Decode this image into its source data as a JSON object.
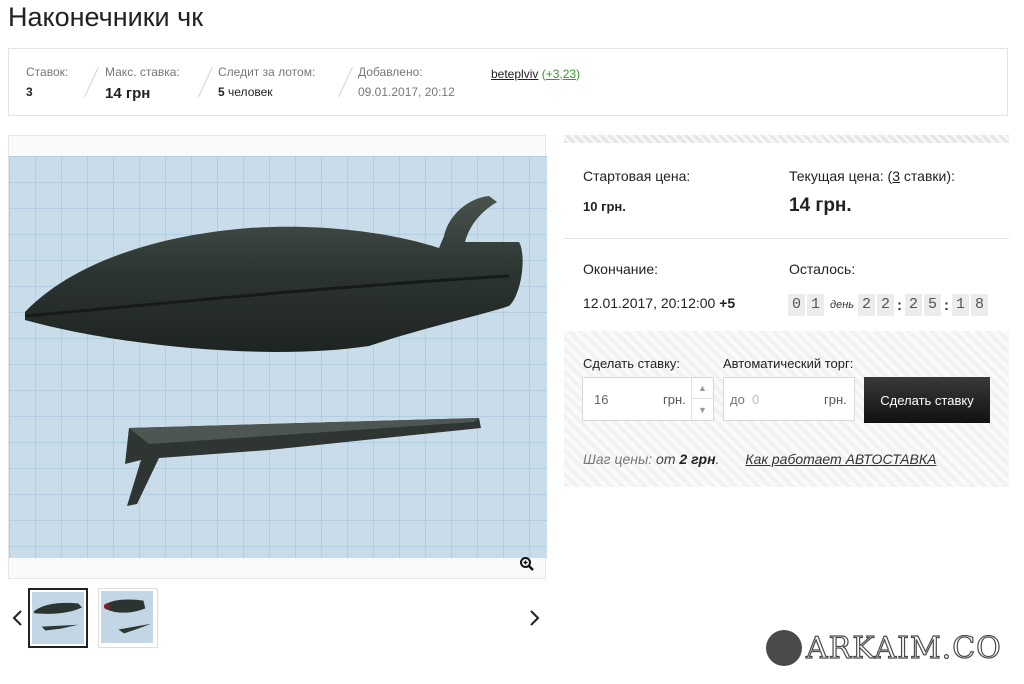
{
  "page": {
    "title": "Наконечники чк"
  },
  "info": {
    "bids_label": "Ставок:",
    "bids_value": "3",
    "max_bid_label": "Макс. ставка:",
    "max_bid_value": "14 грн",
    "watching_label": "Следит за лотом:",
    "watching_count": "5",
    "watching_unit": "человек",
    "added_label": "Добавлено:",
    "added_value": "09.01.2017, 20:12",
    "seller_name": "beteplviv",
    "seller_rating": "+3,23"
  },
  "pricing": {
    "start_label": "Стартовая цена:",
    "start_value": "10 грн.",
    "current_label_prefix": "Текущая цена: (",
    "current_label_count": "3",
    "current_label_suffix": " ставки):",
    "current_value": "14 грн.",
    "end_label": "Окончание:",
    "end_value": "12.01.2017, 20:12:00",
    "end_tz": "+5",
    "remaining_label": "Осталось:",
    "countdown": {
      "d1": "0",
      "d2": "1",
      "day_label": "день",
      "h1": "2",
      "h2": "2",
      "m1": "2",
      "m2": "5",
      "s1": "1",
      "s2": "8"
    }
  },
  "bid": {
    "make_bid_label": "Сделать ставку:",
    "bid_value": "16",
    "bid_unit": "грн.",
    "auto_label": "Автоматический торг:",
    "auto_prefix": "до",
    "auto_placeholder": "0",
    "auto_unit": "грн.",
    "button_label": "Сделать ставку",
    "step_label": "Шаг цены:",
    "step_from": "от",
    "step_value": "2 грн",
    "step_dot": ".",
    "how_link": "Как работает АВТОСТАВКА"
  },
  "watermark": {
    "text": "ARKAIM.CO"
  },
  "colors": {
    "rating_green": "#3a9a2a",
    "button_dark": "#1a1a1a",
    "digit_bg": "#ececec"
  },
  "icons": {
    "zoom": "zoom-in-icon",
    "prev": "chevron-left-icon",
    "next": "chevron-right-icon"
  }
}
